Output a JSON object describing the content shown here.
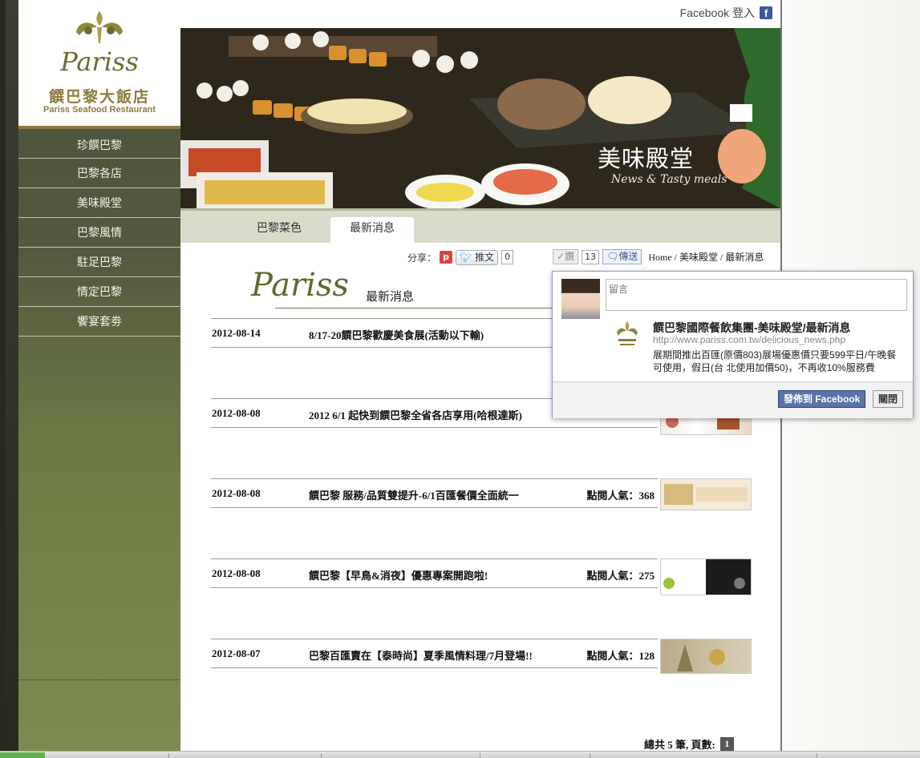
{
  "header": {
    "facebook_login": "Facebook 登入"
  },
  "logo": {
    "script": "Pariss",
    "name_zh": "饌巴黎大飯店",
    "name_en": "Pariss Seafood Restaurant"
  },
  "nav": {
    "items": [
      {
        "label": "珍饌巴黎"
      },
      {
        "label": "巴黎各店"
      },
      {
        "label": "美味殿堂"
      },
      {
        "label": "巴黎風情"
      },
      {
        "label": "駐足巴黎"
      },
      {
        "label": "情定巴黎"
      },
      {
        "label": "饗宴套劵"
      }
    ]
  },
  "banner": {
    "title_zh": "美味殿堂",
    "title_en": "News & Tasty meals"
  },
  "tabs": [
    {
      "label": "巴黎菜色"
    },
    {
      "label": "最新消息"
    }
  ],
  "share": {
    "label": "分享：",
    "tweet_label": "推文",
    "tweet_count": "0",
    "like_label": "讚",
    "like_count": "13",
    "send_label": "傳送"
  },
  "breadcrumb": "Home / 美味殿堂 / 最新消息",
  "section": {
    "script": "Pariss",
    "title": "最新消息"
  },
  "news": [
    {
      "date": "2012-08-14",
      "title": "8/17-20饌巴黎歡慶美食展(活動以下輸)",
      "views": ""
    },
    {
      "date": "2012-08-08",
      "title": "2012 6/1 起快到饌巴黎全省各店享用(哈根達斯)",
      "views": ""
    },
    {
      "date": "2012-08-08",
      "title": "饌巴黎 服務/品質雙提升-6/1百匯餐價全面統一",
      "views": "點閱人氣：368"
    },
    {
      "date": "2012-08-08",
      "title": "饌巴黎【早鳥&消夜】優惠專案開跑啦!",
      "views": "點閱人氣：275"
    },
    {
      "date": "2012-08-07",
      "title": "巴黎百匯賣在【泰時尚】夏季風情料理/7月登場!!",
      "views": "點閱人氣：128"
    }
  ],
  "pager": {
    "summary": "總共 5 筆, 頁數:",
    "current": "1"
  },
  "fb_popup": {
    "comment_placeholder": "留言",
    "link_title": "饌巴黎國際餐飲集團-美味殿堂/最新消息",
    "link_url": "http://www.pariss.com.tw/delicious_news.php",
    "link_desc": "展期間推出百匯(原價803)展場優惠價只要599平日/午晚餐可使用，假日(台 北使用加價50)，不再收10%服務費",
    "post_label": "發佈到 Facebook",
    "close_label": "關閉"
  },
  "colors": {
    "sidebar": "#545a3e",
    "accent": "#5d6a2c",
    "facebook": "#3b5998"
  }
}
